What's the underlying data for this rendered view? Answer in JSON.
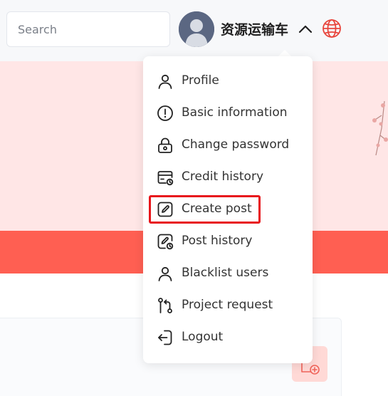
{
  "header": {
    "search_placeholder": "Search",
    "username": "资源运输车"
  },
  "menu": {
    "items": [
      {
        "label": "Profile",
        "icon": "user-icon"
      },
      {
        "label": "Basic information",
        "icon": "info-circle-icon"
      },
      {
        "label": "Change password",
        "icon": "lock-icon"
      },
      {
        "label": "Credit history",
        "icon": "credit-card-history-icon"
      },
      {
        "label": "Create post",
        "icon": "edit-post-icon",
        "highlighted": true
      },
      {
        "label": "Post history",
        "icon": "post-history-icon"
      },
      {
        "label": "Blacklist users",
        "icon": "user-blacklist-icon"
      },
      {
        "label": "Project request",
        "icon": "git-pull-request-icon"
      },
      {
        "label": "Logout",
        "icon": "logout-icon"
      }
    ]
  },
  "colors": {
    "header_bg": "#f7f8fa",
    "banner_bg": "#ffe6e6",
    "accent_red": "#ff5f52",
    "highlight_border": "#e8161c",
    "globe_color": "#e8453c"
  }
}
